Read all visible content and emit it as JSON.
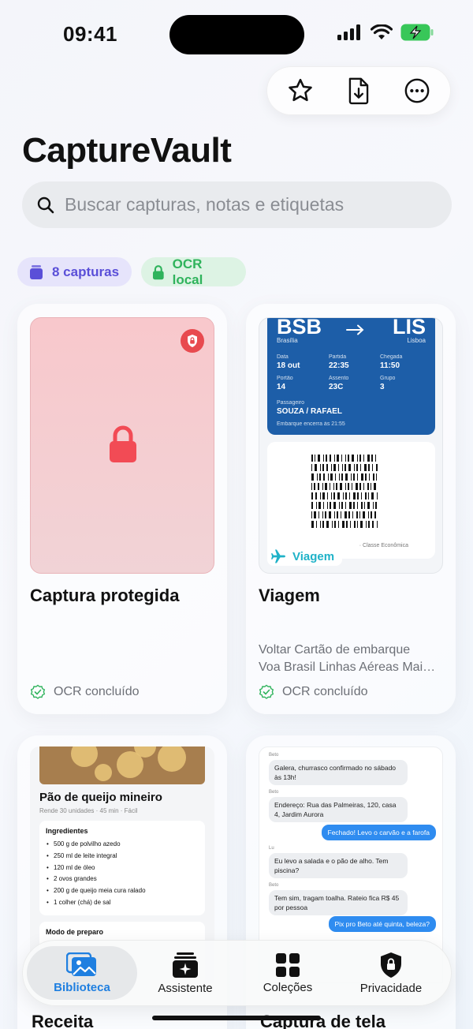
{
  "status": {
    "time": "09:41"
  },
  "app": {
    "title": "CaptureVault"
  },
  "search": {
    "placeholder": "Buscar capturas, notas e etiquetas"
  },
  "chips": [
    {
      "label": "8 capturas",
      "icon": "stack-icon",
      "color": "#5a4fd8"
    },
    {
      "label": "OCR local",
      "icon": "lock-icon",
      "color": "#2fb35c"
    }
  ],
  "cards": [
    {
      "title": "Captura protegida",
      "ocr_status": "OCR concluído",
      "locked": true
    },
    {
      "title": "Viagem",
      "desc_line1": "Voltar Cartão de embarque",
      "desc_line2": "Voa Brasil Linhas Aéreas Mai…",
      "ocr_status": "OCR concluído",
      "tag": "Viagem",
      "pass": {
        "from_code": "BSB",
        "from_city": "Brasília",
        "to_code": "LIS",
        "to_city": "Lisboa",
        "data_label": "Data",
        "data": "18 out",
        "partida_label": "Partida",
        "partida": "22:35",
        "chegada_label": "Chegada",
        "chegada": "11:50",
        "portao_label": "Portão",
        "portao": "14",
        "assento_label": "Assento",
        "assento": "23C",
        "grupo_label": "Grupo",
        "grupo": "3",
        "passageiro_label": "Passageiro",
        "passageiro": "SOUZA / RAFAEL",
        "embarque": "Embarque encerra às 21:55",
        "classe": "· Classe Econômica"
      }
    },
    {
      "title": "Receita",
      "recipe": {
        "name": "Pão de queijo mineiro",
        "meta": "Rende 30 unidades · 45 min · Fácil",
        "ingredients_title": "Ingredientes",
        "ingredients": [
          "500 g de polvilho azedo",
          "250 ml de leite integral",
          "120 ml de óleo",
          "2 ovos grandes",
          "200 g de queijo meia cura ralado",
          "1 colher (chá) de sal"
        ],
        "method_title": "Modo de preparo"
      }
    },
    {
      "title": "Captura de tela",
      "chat": {
        "m1_name": "Beto",
        "m1": "Galera, churrasco confirmado no sábado às 13h!",
        "m2_name": "Beto",
        "m2": "Endereço: Rua das Palmeiras, 120, casa 4, Jardim Aurora",
        "m3": "Fechado! Levo o carvão e a farofa",
        "m4_name": "Lu",
        "m4": "Eu levo a salada e o pão de alho. Tem piscina?",
        "m5_name": "Beto",
        "m5": "Tem sim, tragam toalha. Rateio fica R$ 45 por pessoa",
        "m6": "Pix pro Beto até quinta, beleza?"
      }
    }
  ],
  "tabs": [
    {
      "label": "Biblioteca",
      "icon": "photos-icon",
      "active": true
    },
    {
      "label": "Assistente",
      "icon": "sparkle-icon",
      "active": false
    },
    {
      "label": "Coleções",
      "icon": "grid-icon",
      "active": false
    },
    {
      "label": "Privacidade",
      "icon": "shield-lock-icon",
      "active": false
    }
  ],
  "colors": {
    "accent": "#1f7fe0",
    "danger": "#e84a4f",
    "success": "#2fb35c",
    "pass_blue": "#1d5ea8"
  }
}
